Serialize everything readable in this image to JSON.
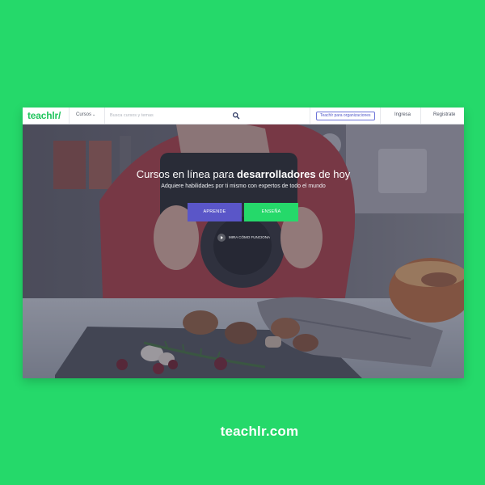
{
  "nav": {
    "logo_text": "teachlr",
    "courses_label": "Cursos",
    "search_placeholder": "Busca cursos y temas",
    "org_button_label": "Teachlr para organizaciones",
    "login_label": "Ingresa",
    "register_label": "Registrate",
    "accent_color": "#22c55e"
  },
  "hero": {
    "title_prefix": "Cursos en línea para ",
    "title_emphasis": "desarrolladores",
    "title_suffix": " de hoy",
    "subtitle": "Adquiere habilidades por ti mismo con expertos de todo el mundo",
    "learn_button_label": "APRENDE",
    "teach_button_label": "ENSEÑA",
    "watch_label": "MIRA CÓMO FUNCIONA",
    "learn_color": "#5a56c8",
    "teach_color": "#25d96a"
  },
  "icons": {
    "search": "search-icon",
    "play": "play-icon",
    "dropdown": "chevron-down-icon"
  },
  "footer": {
    "site_url": "teachlr.com",
    "background_color": "#25d96a"
  }
}
